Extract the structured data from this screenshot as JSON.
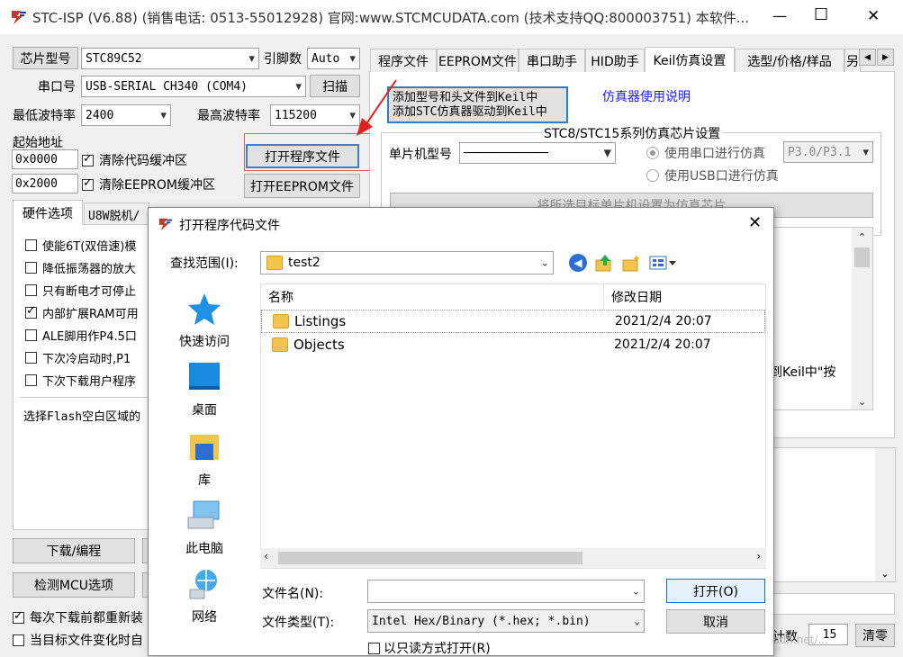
{
  "window": {
    "title": "STC-ISP (V6.88) (销售电话: 0513-55012928) 官网:www.STCMCUDATA.com  (技术支持QQ:800003751) 本软件...",
    "min": "—",
    "max": "☐",
    "close": "✕"
  },
  "left": {
    "chip_label": "芯片型号",
    "chip_value": "STC89C52",
    "pins_label": "引脚数",
    "pins_value": "Auto",
    "port_label": "串口号",
    "port_value": "USB-SERIAL CH340 (COM4)",
    "scan": "扫描",
    "min_baud_label": "最低波特率",
    "min_baud_value": "2400",
    "max_baud_label": "最高波特率",
    "max_baud_value": "115200",
    "start_addr_label": "起始地址",
    "addr1": "0x0000",
    "clear_code": "清除代码缓冲区",
    "open_program": "打开程序文件",
    "addr2": "0x2000",
    "clear_eeprom": "清除EEPROM缓冲区",
    "open_eeprom": "打开EEPROM文件",
    "tab_hw": "硬件选项",
    "tab_u8w": "U8W脱机/",
    "options": [
      {
        "label": "使能6T(双倍速)模",
        "checked": false
      },
      {
        "label": "降低振荡器的放大",
        "checked": false
      },
      {
        "label": "只有断电才可停止",
        "checked": false
      },
      {
        "label": "内部扩展RAM可用",
        "checked": true
      },
      {
        "label": "ALE脚用作P4.5口",
        "checked": false
      },
      {
        "label": "下次冷启动时,P1",
        "checked": false
      },
      {
        "label": "下次下载用户程序",
        "checked": false
      }
    ],
    "flash_fill": "选择Flash空白区域的",
    "download": "下载/编程",
    "detect": "检测MCU选项",
    "reload_each": "每次下载前都重新装",
    "reload_checked": true,
    "auto_target": "当目标文件变化时自",
    "auto_checked": false
  },
  "right": {
    "tabs": [
      "程序文件",
      "EEPROM文件",
      "串口助手",
      "HID助手",
      "Keil仿真设置",
      "选型/价格/样品",
      "另"
    ],
    "add_keil_line1": "添加型号和头文件到Keil中",
    "add_keil_line2": "添加STC仿真器驱动到Keil中",
    "sim_manual": "仿真器使用说明",
    "group_title": "STC8/STC15系列仿真芯片设置",
    "mcu_label": "单片机型号",
    "mcu_value": "────────────",
    "radio_serial": "使用串口进行仿真",
    "radio_usb": "使用USB口进行仿真",
    "port_pins": "P3.0/P3.1",
    "set_chip": "将所选目标单片机设置为仿真芯片",
    "keil_hint": "到Keil中\"按",
    "count_label": "计数",
    "count_value": "15",
    "clear": "清零",
    "watermark": "https://blog.csdn.net/..."
  },
  "dialog": {
    "title": "打开程序代码文件",
    "lookin_label": "查找范围(I):",
    "lookin_value": "test2",
    "sidebar": [
      "快速访问",
      "桌面",
      "库",
      "此电脑",
      "网络"
    ],
    "col_name": "名称",
    "col_date": "修改日期",
    "files": [
      {
        "name": "Listings",
        "date": "2021/2/4 20:07"
      },
      {
        "name": "Objects",
        "date": "2021/2/4 20:07"
      }
    ],
    "filename_label": "文件名(N):",
    "filename_value": "",
    "filetype_label": "文件类型(T):",
    "filetype_value": "Intel Hex/Binary (*.hex; *.bin)",
    "open": "打开(O)",
    "cancel": "取消",
    "readonly": "以只读方式打开(R)"
  }
}
